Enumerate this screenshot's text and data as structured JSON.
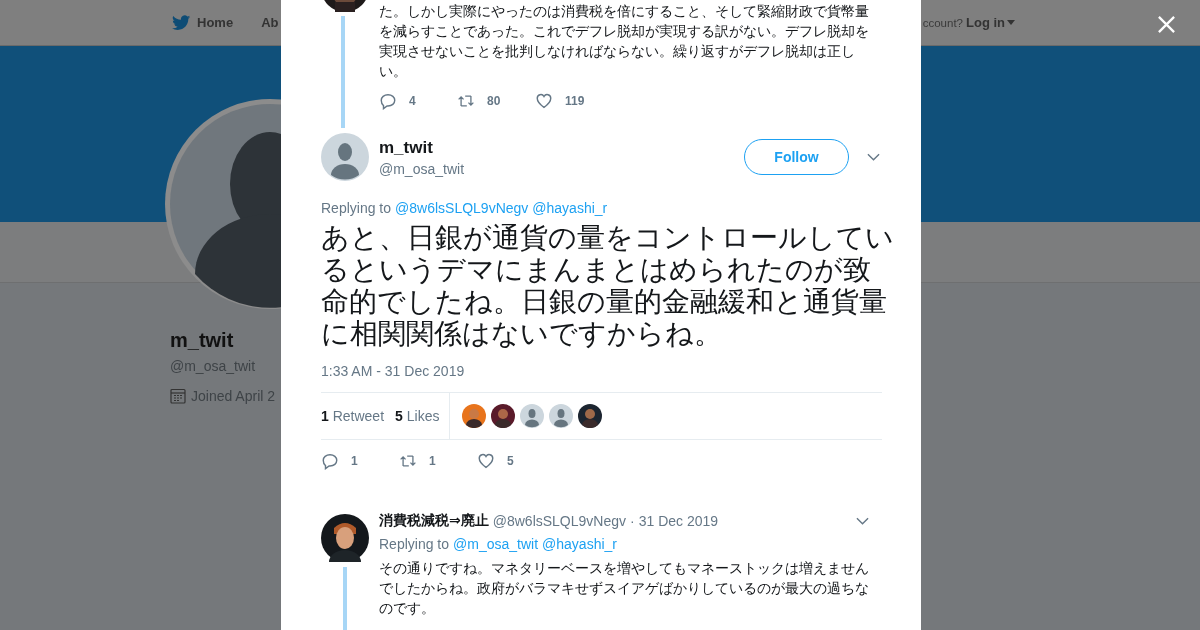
{
  "nav": {
    "items": [
      {
        "kind": "home",
        "label": "Home"
      },
      {
        "kind": "link",
        "label": "Ab"
      }
    ],
    "account_prompt": "ccount?",
    "login": "Log in"
  },
  "profile": {
    "name": "m_twit",
    "handle": "@m_osa_twit",
    "joined": "Joined April 2"
  },
  "previous_tweet": {
    "text": "た。しかし実際にやったのは消費税を倍にすること、そして緊縮財政で貨幣量を減らすことであった。これでデフレ脱却が実現する訳がない。デフレ脱却を実現させないことを批判しなければならない。繰り返すがデフレ脱却は正しい。",
    "actions": [
      {
        "kind": "reply",
        "count": "4"
      },
      {
        "kind": "retweet",
        "count": "80"
      },
      {
        "kind": "like",
        "count": "119"
      }
    ]
  },
  "tweet": {
    "name": "m_twit",
    "handle": "@m_osa_twit",
    "follow": "Follow",
    "replying_label": "Replying to",
    "replying_to": [
      "@8w6lsSLQL9vNegv",
      "@hayashi_r"
    ],
    "text": "あと、日銀が通貨の量をコントロールしているというデマにまんまとはめられたのが致命的でしたね。日銀の量的金融緩和と通貨量に相関関係はないですからね。",
    "timestamp": "1:33 AM - 31 Dec 2019",
    "stats": [
      {
        "count": "1",
        "label": "Retweet"
      },
      {
        "count": "5",
        "label": "Likes"
      }
    ],
    "likers": [
      {
        "kind": "picture",
        "color": "#e8741c"
      },
      {
        "kind": "picture",
        "color": "#5a1a2a"
      },
      {
        "kind": "default"
      },
      {
        "kind": "default"
      },
      {
        "kind": "picture",
        "color": "#1c2530"
      }
    ],
    "actions": [
      {
        "kind": "reply",
        "count": "1"
      },
      {
        "kind": "retweet",
        "count": "1"
      },
      {
        "kind": "like",
        "count": "5"
      }
    ]
  },
  "reply": {
    "name": "消費税減税⇒廃止",
    "handle": "@8w6lsSLQL9vNegv",
    "separator": "·",
    "date": "31 Dec 2019",
    "replying_label": "Replying to",
    "replying_to": [
      "@m_osa_twit",
      "@hayashi_r"
    ],
    "text": "その通りですね。マネタリーベースを増やしてもマネーストックは増えませんでしたからね。政府がバラマキせずスイアゲばかりしているのが最大の過ちなのです。"
  }
}
